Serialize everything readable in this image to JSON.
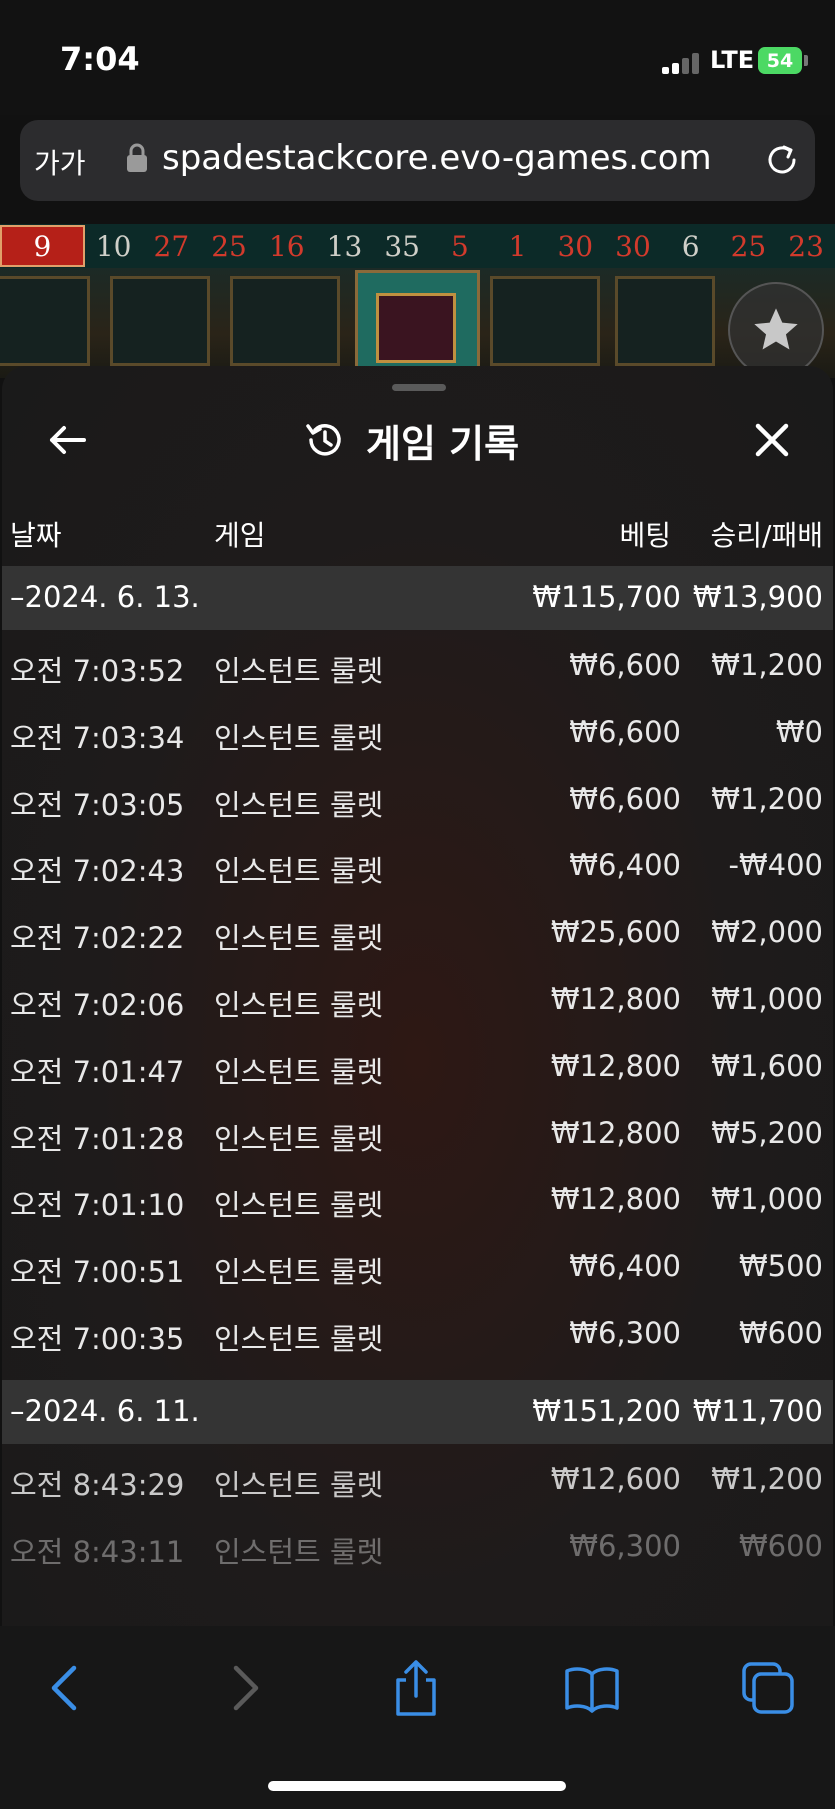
{
  "status_bar": {
    "time": "7:04",
    "network": "LTE",
    "battery": "54"
  },
  "browser": {
    "text_size_label": "가가",
    "url": "spadestackcore.evo-games.com"
  },
  "roulette_history": [
    {
      "n": "9",
      "c": "red"
    },
    {
      "n": "10",
      "c": "black"
    },
    {
      "n": "27",
      "c": "red"
    },
    {
      "n": "25",
      "c": "red"
    },
    {
      "n": "16",
      "c": "red"
    },
    {
      "n": "13",
      "c": "black"
    },
    {
      "n": "35",
      "c": "black"
    },
    {
      "n": "5",
      "c": "red"
    },
    {
      "n": "1",
      "c": "red"
    },
    {
      "n": "30",
      "c": "red"
    },
    {
      "n": "30",
      "c": "red"
    },
    {
      "n": "6",
      "c": "black"
    },
    {
      "n": "25",
      "c": "red"
    },
    {
      "n": "23",
      "c": "red"
    }
  ],
  "sheet": {
    "title": "게임 기록",
    "columns": {
      "date": "날짜",
      "game": "게임",
      "bet": "베팅",
      "win_loss": "승리/패배"
    },
    "groups": [
      {
        "date": "–2024. 6. 13.",
        "bet_total": "₩115,700",
        "win_total": "₩13,900",
        "rows": [
          {
            "time": "오전 7:03:52",
            "game": "인스턴트 룰렛",
            "bet": "₩6,600",
            "win": "₩1,200"
          },
          {
            "time": "오전 7:03:34",
            "game": "인스턴트 룰렛",
            "bet": "₩6,600",
            "win": "₩0"
          },
          {
            "time": "오전 7:03:05",
            "game": "인스턴트 룰렛",
            "bet": "₩6,600",
            "win": "₩1,200"
          },
          {
            "time": "오전 7:02:43",
            "game": "인스턴트 룰렛",
            "bet": "₩6,400",
            "win": "-₩400"
          },
          {
            "time": "오전 7:02:22",
            "game": "인스턴트 룰렛",
            "bet": "₩25,600",
            "win": "₩2,000"
          },
          {
            "time": "오전 7:02:06",
            "game": "인스턴트 룰렛",
            "bet": "₩12,800",
            "win": "₩1,000"
          },
          {
            "time": "오전 7:01:47",
            "game": "인스턴트 룰렛",
            "bet": "₩12,800",
            "win": "₩1,600"
          },
          {
            "time": "오전 7:01:28",
            "game": "인스턴트 룰렛",
            "bet": "₩12,800",
            "win": "₩5,200"
          },
          {
            "time": "오전 7:01:10",
            "game": "인스턴트 룰렛",
            "bet": "₩12,800",
            "win": "₩1,000"
          },
          {
            "time": "오전 7:00:51",
            "game": "인스턴트 룰렛",
            "bet": "₩6,400",
            "win": "₩500"
          },
          {
            "time": "오전 7:00:35",
            "game": "인스턴트 룰렛",
            "bet": "₩6,300",
            "win": "₩600"
          }
        ]
      },
      {
        "date": "–2024. 6. 11.",
        "bet_total": "₩151,200",
        "win_total": "₩11,700",
        "rows": [
          {
            "time": "오전 8:43:29",
            "game": "인스턴트 룰렛",
            "bet": "₩12,600",
            "win": "₩1,200"
          },
          {
            "time": "오전 8:43:11",
            "game": "인스턴트 룰렛",
            "bet": "₩6,300",
            "win": "₩600"
          }
        ]
      }
    ]
  },
  "colors": {
    "ios_blue": "#3a8ee6",
    "battery_green": "#4cd964",
    "roulette_red": "#b52018"
  }
}
